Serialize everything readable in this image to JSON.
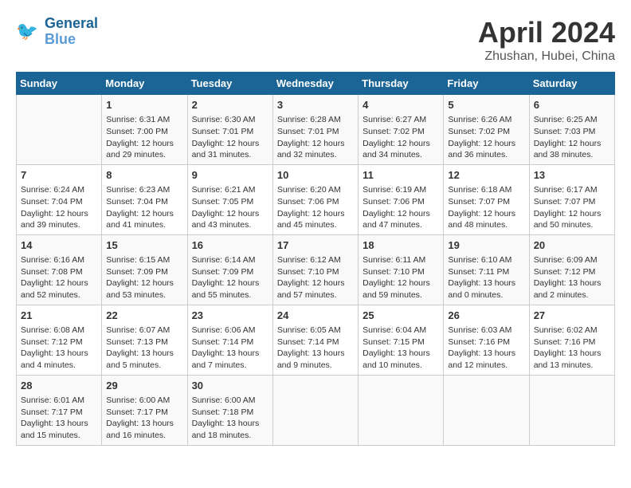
{
  "header": {
    "logo_line1": "General",
    "logo_line2": "Blue",
    "month": "April 2024",
    "location": "Zhushan, Hubei, China"
  },
  "weekdays": [
    "Sunday",
    "Monday",
    "Tuesday",
    "Wednesday",
    "Thursday",
    "Friday",
    "Saturday"
  ],
  "weeks": [
    [
      {
        "day": "",
        "info": ""
      },
      {
        "day": "1",
        "info": "Sunrise: 6:31 AM\nSunset: 7:00 PM\nDaylight: 12 hours\nand 29 minutes."
      },
      {
        "day": "2",
        "info": "Sunrise: 6:30 AM\nSunset: 7:01 PM\nDaylight: 12 hours\nand 31 minutes."
      },
      {
        "day": "3",
        "info": "Sunrise: 6:28 AM\nSunset: 7:01 PM\nDaylight: 12 hours\nand 32 minutes."
      },
      {
        "day": "4",
        "info": "Sunrise: 6:27 AM\nSunset: 7:02 PM\nDaylight: 12 hours\nand 34 minutes."
      },
      {
        "day": "5",
        "info": "Sunrise: 6:26 AM\nSunset: 7:02 PM\nDaylight: 12 hours\nand 36 minutes."
      },
      {
        "day": "6",
        "info": "Sunrise: 6:25 AM\nSunset: 7:03 PM\nDaylight: 12 hours\nand 38 minutes."
      }
    ],
    [
      {
        "day": "7",
        "info": "Sunrise: 6:24 AM\nSunset: 7:04 PM\nDaylight: 12 hours\nand 39 minutes."
      },
      {
        "day": "8",
        "info": "Sunrise: 6:23 AM\nSunset: 7:04 PM\nDaylight: 12 hours\nand 41 minutes."
      },
      {
        "day": "9",
        "info": "Sunrise: 6:21 AM\nSunset: 7:05 PM\nDaylight: 12 hours\nand 43 minutes."
      },
      {
        "day": "10",
        "info": "Sunrise: 6:20 AM\nSunset: 7:06 PM\nDaylight: 12 hours\nand 45 minutes."
      },
      {
        "day": "11",
        "info": "Sunrise: 6:19 AM\nSunset: 7:06 PM\nDaylight: 12 hours\nand 47 minutes."
      },
      {
        "day": "12",
        "info": "Sunrise: 6:18 AM\nSunset: 7:07 PM\nDaylight: 12 hours\nand 48 minutes."
      },
      {
        "day": "13",
        "info": "Sunrise: 6:17 AM\nSunset: 7:07 PM\nDaylight: 12 hours\nand 50 minutes."
      }
    ],
    [
      {
        "day": "14",
        "info": "Sunrise: 6:16 AM\nSunset: 7:08 PM\nDaylight: 12 hours\nand 52 minutes."
      },
      {
        "day": "15",
        "info": "Sunrise: 6:15 AM\nSunset: 7:09 PM\nDaylight: 12 hours\nand 53 minutes."
      },
      {
        "day": "16",
        "info": "Sunrise: 6:14 AM\nSunset: 7:09 PM\nDaylight: 12 hours\nand 55 minutes."
      },
      {
        "day": "17",
        "info": "Sunrise: 6:12 AM\nSunset: 7:10 PM\nDaylight: 12 hours\nand 57 minutes."
      },
      {
        "day": "18",
        "info": "Sunrise: 6:11 AM\nSunset: 7:10 PM\nDaylight: 12 hours\nand 59 minutes."
      },
      {
        "day": "19",
        "info": "Sunrise: 6:10 AM\nSunset: 7:11 PM\nDaylight: 13 hours\nand 0 minutes."
      },
      {
        "day": "20",
        "info": "Sunrise: 6:09 AM\nSunset: 7:12 PM\nDaylight: 13 hours\nand 2 minutes."
      }
    ],
    [
      {
        "day": "21",
        "info": "Sunrise: 6:08 AM\nSunset: 7:12 PM\nDaylight: 13 hours\nand 4 minutes."
      },
      {
        "day": "22",
        "info": "Sunrise: 6:07 AM\nSunset: 7:13 PM\nDaylight: 13 hours\nand 5 minutes."
      },
      {
        "day": "23",
        "info": "Sunrise: 6:06 AM\nSunset: 7:14 PM\nDaylight: 13 hours\nand 7 minutes."
      },
      {
        "day": "24",
        "info": "Sunrise: 6:05 AM\nSunset: 7:14 PM\nDaylight: 13 hours\nand 9 minutes."
      },
      {
        "day": "25",
        "info": "Sunrise: 6:04 AM\nSunset: 7:15 PM\nDaylight: 13 hours\nand 10 minutes."
      },
      {
        "day": "26",
        "info": "Sunrise: 6:03 AM\nSunset: 7:16 PM\nDaylight: 13 hours\nand 12 minutes."
      },
      {
        "day": "27",
        "info": "Sunrise: 6:02 AM\nSunset: 7:16 PM\nDaylight: 13 hours\nand 13 minutes."
      }
    ],
    [
      {
        "day": "28",
        "info": "Sunrise: 6:01 AM\nSunset: 7:17 PM\nDaylight: 13 hours\nand 15 minutes."
      },
      {
        "day": "29",
        "info": "Sunrise: 6:00 AM\nSunset: 7:17 PM\nDaylight: 13 hours\nand 16 minutes."
      },
      {
        "day": "30",
        "info": "Sunrise: 6:00 AM\nSunset: 7:18 PM\nDaylight: 13 hours\nand 18 minutes."
      },
      {
        "day": "",
        "info": ""
      },
      {
        "day": "",
        "info": ""
      },
      {
        "day": "",
        "info": ""
      },
      {
        "day": "",
        "info": ""
      }
    ]
  ]
}
